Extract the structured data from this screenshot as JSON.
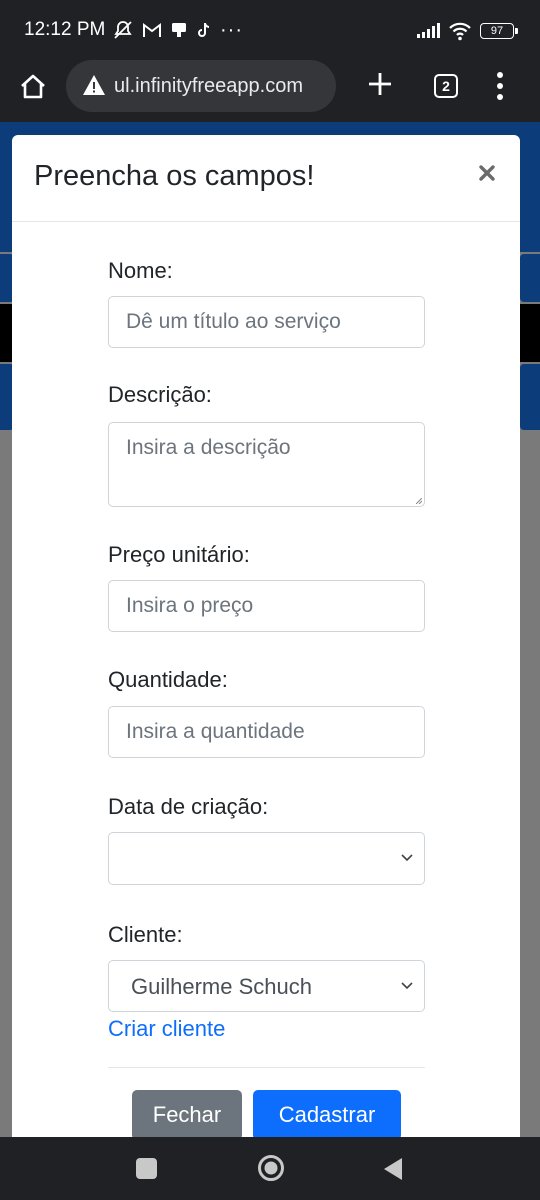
{
  "status_bar": {
    "time": "12:12 PM",
    "more": "···",
    "battery": "97",
    "icons": [
      "mute-icon",
      "gmail-icon",
      "chat-icon",
      "tiktok-icon",
      "signal-icon",
      "wifi-icon",
      "battery-icon"
    ]
  },
  "browser": {
    "url": "ul.infinityfreeapp.com",
    "tab_count": "2",
    "icons": [
      "home-icon",
      "warning-icon",
      "plus-icon",
      "tabs-icon",
      "menu-icon"
    ]
  },
  "modal": {
    "title": "Preencha os campos!",
    "close_icon": "close-icon",
    "fields": {
      "nome": {
        "label": "Nome:",
        "placeholder": "Dê um título ao serviço"
      },
      "descricao": {
        "label": "Descrição:",
        "placeholder": "Insira a descrição"
      },
      "preco": {
        "label": "Preço unitário:",
        "placeholder": "Insira o preço"
      },
      "quantidade": {
        "label": "Quantidade:",
        "placeholder": "Insira a quantidade"
      },
      "data": {
        "label": "Data de criação:",
        "value": ""
      },
      "cliente": {
        "label": "Cliente:",
        "value": "Guilherme Schuch"
      }
    },
    "create_client_link": "Criar cliente",
    "buttons": {
      "close": "Fechar",
      "submit": "Cadastrar"
    },
    "colors": {
      "primary": "#0d6efd",
      "secondary": "#6c757d"
    }
  },
  "nav_bar": {
    "icons": [
      "recents-icon",
      "home-circle-icon",
      "back-icon"
    ]
  }
}
